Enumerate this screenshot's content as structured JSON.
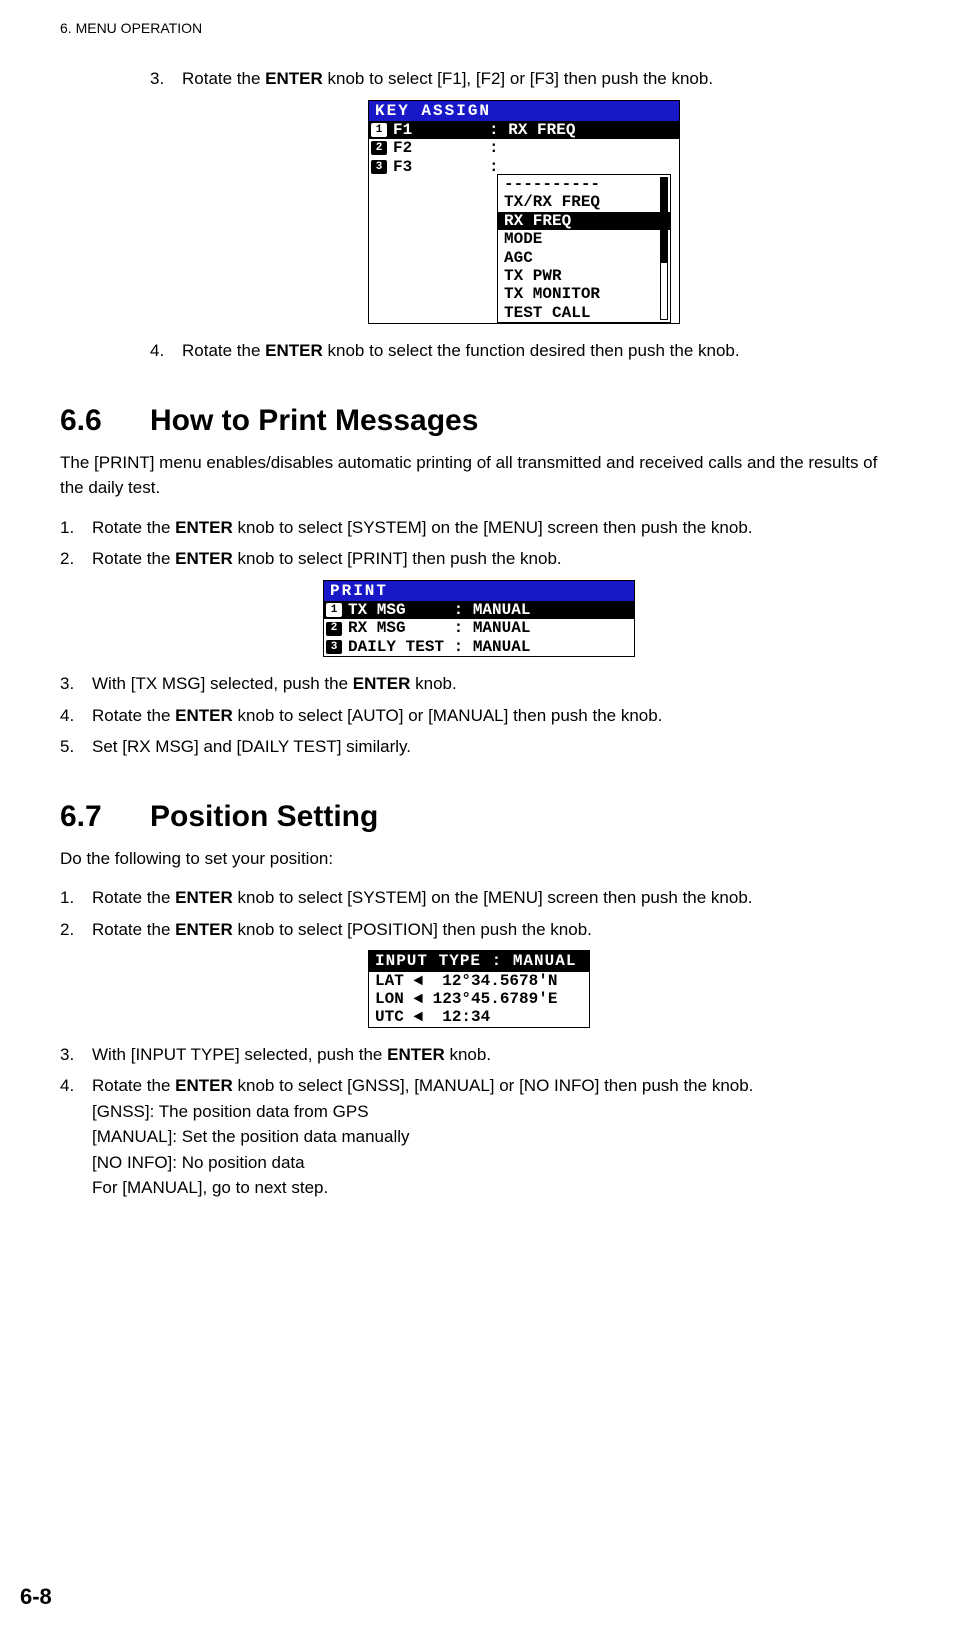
{
  "header": "6.  MENU OPERATION",
  "page_number": "6-8",
  "step3_top": {
    "num": "3.",
    "text_a": "Rotate the ",
    "text_b": "ENTER",
    "text_c": " knob to select [F1], [F2] or [F3] then push the knob."
  },
  "lcd_key": {
    "title": " KEY ASSIGN",
    "r1": {
      "badge": "1",
      "label": "F1        : RX FREQ"
    },
    "r2": {
      "badge": "2",
      "label": "F2        : "
    },
    "r3": {
      "badge": "3",
      "label": "F3        : "
    },
    "drop": {
      "d0": "----------",
      "d1": "TX/RX FREQ",
      "d2": "RX FREQ",
      "d3": "MODE",
      "d4": "AGC",
      "d5": "TX PWR",
      "d6": "TX MONITOR",
      "d7": "TEST CALL"
    }
  },
  "step4_top": {
    "num": "4.",
    "text_a": "Rotate the ",
    "text_b": "ENTER",
    "text_c": " knob to select the function desired then push the knob."
  },
  "sec66": {
    "num": "6.6",
    "title": "How to Print Messages",
    "intro": "The [PRINT] menu enables/disables automatic printing of all transmitted and received calls and the results of the daily test.",
    "s1": {
      "num": "1.",
      "a": "Rotate the ",
      "b": "ENTER",
      "c": " knob to select [SYSTEM] on the [MENU] screen then push the knob."
    },
    "s2": {
      "num": "2.",
      "a": "Rotate the ",
      "b": "ENTER",
      "c": " knob to select [PRINT] then push the knob."
    },
    "lcd": {
      "title": " PRINT",
      "r1": {
        "badge": "1",
        "label": "TX MSG     : MANUAL"
      },
      "r2": {
        "badge": "2",
        "label": "RX MSG     : MANUAL"
      },
      "r3": {
        "badge": "3",
        "label": "DAILY TEST : MANUAL"
      }
    },
    "s3": {
      "num": "3.",
      "a": "With [TX MSG] selected, push the ",
      "b": "ENTER",
      "c": " knob."
    },
    "s4": {
      "num": "4.",
      "a": "Rotate the ",
      "b": "ENTER",
      "c": " knob to select [AUTO] or [MANUAL] then push the knob."
    },
    "s5": {
      "num": "5.",
      "a": "Set [RX MSG] and [DAILY TEST] similarly."
    }
  },
  "sec67": {
    "num": "6.7",
    "title": "Position Setting",
    "intro": "Do the following to set your position:",
    "s1": {
      "num": "1.",
      "a": "Rotate the ",
      "b": "ENTER",
      "c": " knob to select [SYSTEM] on the [MENU] screen then push the knob."
    },
    "s2": {
      "num": "2.",
      "a": "Rotate the ",
      "b": "ENTER",
      "c": " knob to select [POSITION] then push the knob."
    },
    "lcd": {
      "title": "INPUT TYPE : MANUAL",
      "r1": "LAT ◄  12°34.5678'N",
      "r2": "LON ◄ 123°45.6789'E",
      "r3": "UTC ◄  12:34"
    },
    "s3": {
      "num": "3.",
      "a": "With [INPUT TYPE] selected, push the ",
      "b": "ENTER",
      "c": " knob."
    },
    "s4": {
      "num": "4.",
      "a": "Rotate the ",
      "b": "ENTER",
      "c": " knob to select [GNSS], [MANUAL] or [NO INFO] then push the knob.",
      "l1": "[GNSS]: The position data from GPS",
      "l2": "[MANUAL]: Set the position data manually",
      "l3": "[NO INFO]: No position data",
      "l4": "For [MANUAL], go to next step."
    }
  }
}
